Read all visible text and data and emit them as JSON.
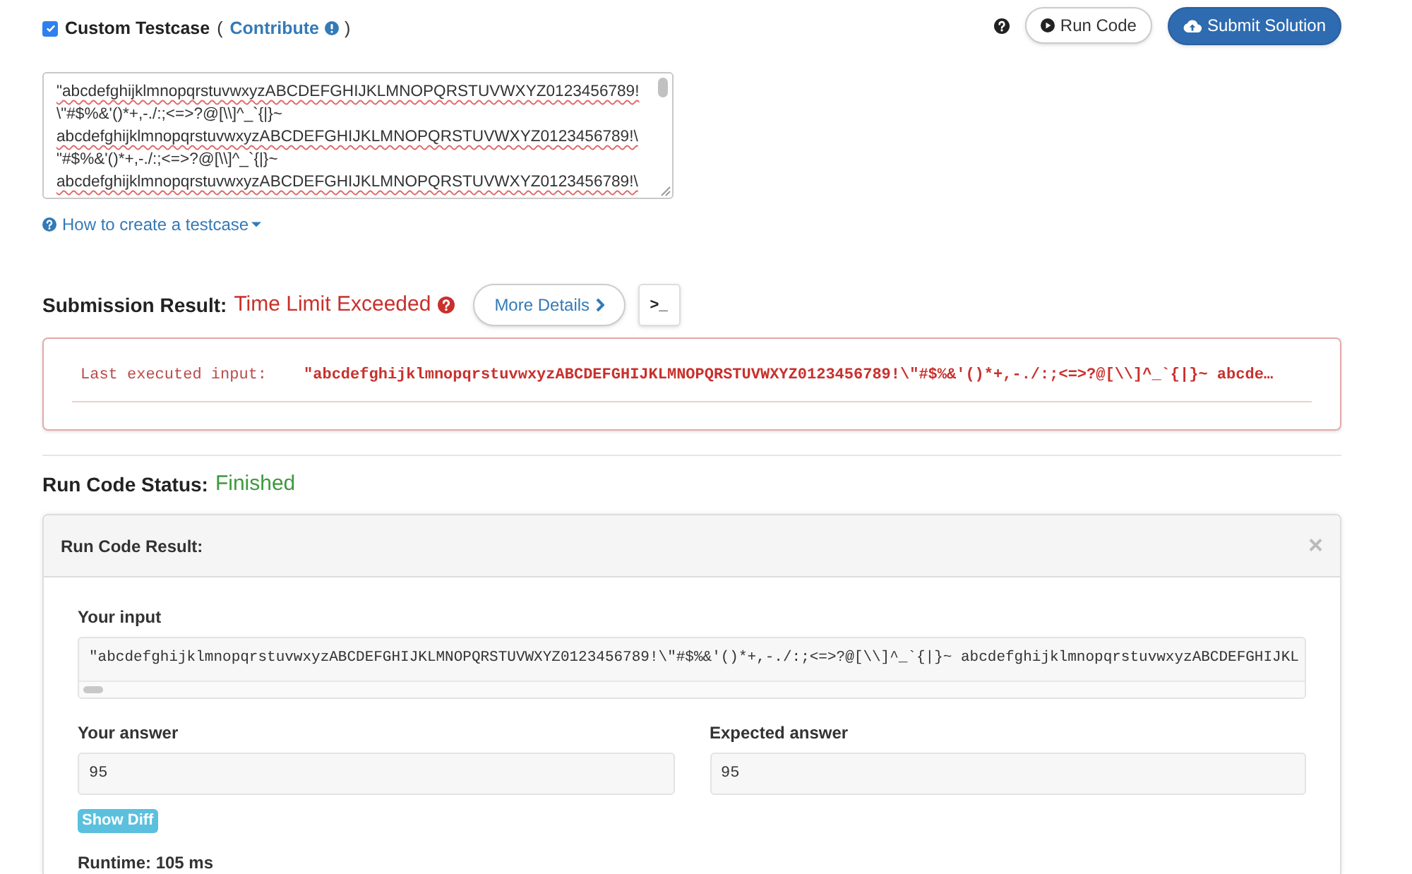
{
  "custom_testcase": {
    "checked": true,
    "label": "Custom Testcase",
    "open_paren": "(",
    "link": "Contribute",
    "close_paren": ")"
  },
  "toolbar_buttons": [
    {
      "kind": "outline",
      "label": "Run Code"
    },
    {
      "kind": "primary",
      "label": "Submit Solution"
    }
  ],
  "testcase_input": {
    "lines": [
      {
        "text": "\"abcdefghijklmnopqrstuvwxyzABCDEFGHIJKLMNOPQRSTUVWXYZ0123456789!",
        "flagged": true
      },
      {
        "text": "\\\"#$%&'()*+,-./:;<=>?@[\\\\]^_`{|}~",
        "flagged": false
      },
      {
        "text": "abcdefghijklmnopqrstuvwxyzABCDEFGHIJKLMNOPQRSTUVWXYZ0123456789!\\",
        "flagged": true
      },
      {
        "text": "\"#$%&'()*+,-./:;<=>?@[\\\\]^_`{|}~",
        "flagged": false
      },
      {
        "text": "abcdefghijklmnopqrstuvwxyzABCDEFGHIJKLMNOPQRSTUVWXYZ0123456789!\\",
        "flagged": true
      }
    ]
  },
  "help_link": "How to create a testcase",
  "submission_result": {
    "label": "Submission Result:",
    "status": "Time Limit Exceeded",
    "kind": "error",
    "details_button": "More Details",
    "console_button": ">_"
  },
  "last_executed_input": {
    "label": "Last executed input:",
    "value": "\"abcdefghijklmnopqrstuvwxyzABCDEFGHIJKLMNOPQRSTUVWXYZ0123456789!\\\"#$%&'()*+,-./:;<=>?@[\\\\]^_`{|}~ abcde…"
  },
  "run_code_status": {
    "label": "Run Code Status:",
    "status": "Finished",
    "kind": "success"
  },
  "run_code_result": {
    "title": "Run Code Result:",
    "close": "×",
    "input_label": "Your input",
    "input_value": "\"abcdefghijklmnopqrstuvwxyzABCDEFGHIJKLMNOPQRSTUVWXYZ0123456789!\\\"#$%&'()*+,-./:;<=>?@[\\\\]^_`{|}~ abcdefghijklmnopqrstuvwxyzABCDEFGHIJKL",
    "answers": [
      {
        "label": "Your answer",
        "value": "95"
      },
      {
        "label": "Expected answer",
        "value": "95"
      }
    ],
    "diff_button": "Show Diff",
    "runtime": "Runtime: 105 ms"
  }
}
